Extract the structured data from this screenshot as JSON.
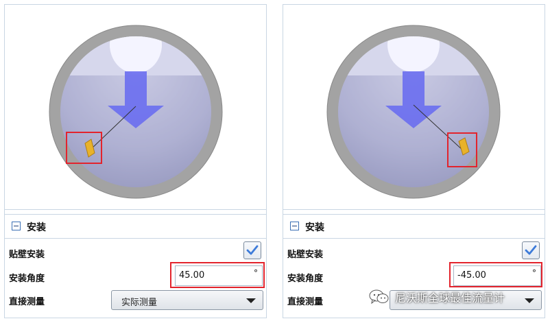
{
  "panels": [
    {
      "section_title": "安装",
      "wall_mount": {
        "label": "贴壁安装",
        "checked": true
      },
      "install_angle": {
        "label": "安装角度",
        "value": "45.00",
        "unit": "°"
      },
      "direct_measure": {
        "label": "直接测量",
        "selected": "实际测量"
      }
    },
    {
      "section_title": "安装",
      "wall_mount": {
        "label": "贴壁安装",
        "checked": true
      },
      "install_angle": {
        "label": "安装角度",
        "value": "-45.00",
        "unit": "°"
      },
      "direct_measure": {
        "label": "直接测量",
        "selected": ""
      }
    }
  ],
  "watermark": {
    "text": "尼沃斯全球最佳流量计",
    "icon": "wechat-icon"
  },
  "colors": {
    "highlight": "#e3232c",
    "flow_arrow": "#6a6ef0",
    "sensor": "#e8b22a",
    "pipe": "#a3a3a3",
    "check": "#3d7bd9"
  }
}
